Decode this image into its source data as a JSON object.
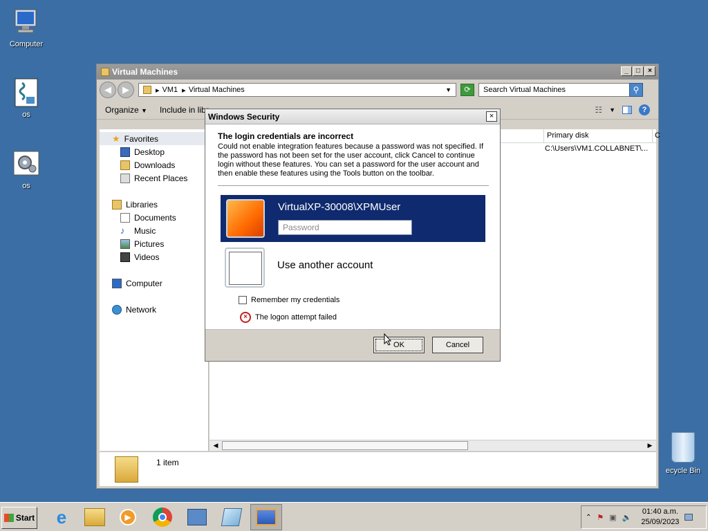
{
  "desktop": {
    "icons": [
      {
        "label": "Computer"
      },
      {
        "label": "os"
      },
      {
        "label": "os"
      }
    ],
    "recycle_label": "ecycle Bin"
  },
  "explorer": {
    "title": "Virtual Machines",
    "address": {
      "crumb1": "VM1",
      "crumb2": "Virtual Machines"
    },
    "search_placeholder": "Search Virtual Machines",
    "toolbar": {
      "organize": "Organize",
      "include": "Include in libr"
    },
    "nav": {
      "favorites": "Favorites",
      "desktop": "Desktop",
      "downloads": "Downloads",
      "recent": "Recent Places",
      "libraries": "Libraries",
      "documents": "Documents",
      "music": "Music",
      "pictures": "Pictures",
      "videos": "Videos",
      "computer": "Computer",
      "network": "Network"
    },
    "columns": {
      "primary_disk": "Primary disk",
      "partial": "C"
    },
    "row_primary_disk": "C:\\Users\\VM1.COLLABNET\\...",
    "details_count": "1 item"
  },
  "dialog": {
    "title": "Windows Security",
    "heading": "The login credentials are incorrect",
    "message": "Could not enable integration features because a password was not specified. If the password has not been set for the user account, click Cancel to continue login without these features. You can set a password for the user account and then enable these features using the Tools button on the toolbar.",
    "account_name": "VirtualXP-30008\\XPMUser",
    "password_placeholder": "Password",
    "other_account": "Use another account",
    "remember": "Remember my credentials",
    "status": "The logon attempt failed",
    "ok": "OK",
    "cancel": "Cancel"
  },
  "taskbar": {
    "start": "Start",
    "time": "01:40 a.m.",
    "date": "25/09/2023"
  }
}
